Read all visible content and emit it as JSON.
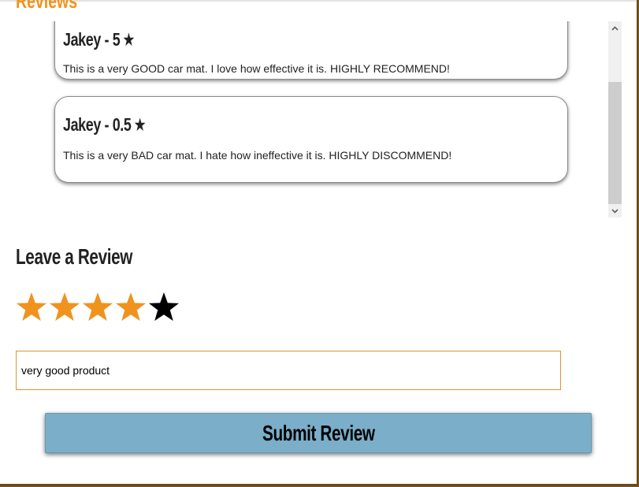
{
  "section": {
    "title": "Reviews"
  },
  "reviews": [
    {
      "author": "Jakey",
      "rating": "5",
      "heading": "Jakey - 5",
      "text": "This is a very GOOD car mat. I love how effective it is. HIGHLY RECOMMEND!"
    },
    {
      "author": "Jakey",
      "rating": "0.5",
      "heading": "Jakey - 0.5",
      "text": "This is a very BAD car mat. I hate how ineffective it is. HIGHLY DISCOMMEND!"
    }
  ],
  "star_glyph": "★",
  "leave_review": {
    "title": "Leave a Review",
    "selected_rating": 4,
    "max_rating": 5,
    "input_value": "very good product",
    "submit_label": "Submit Review"
  },
  "colors": {
    "accent_orange": "#f0931e",
    "star_filled": "#f0931e",
    "star_empty": "#000000",
    "button_blue": "#7aaec9",
    "input_border": "#d9962f"
  },
  "icons": {
    "scroll_up": "chevron-up-icon",
    "scroll_down": "chevron-down-icon",
    "rating_star": "star-icon"
  }
}
